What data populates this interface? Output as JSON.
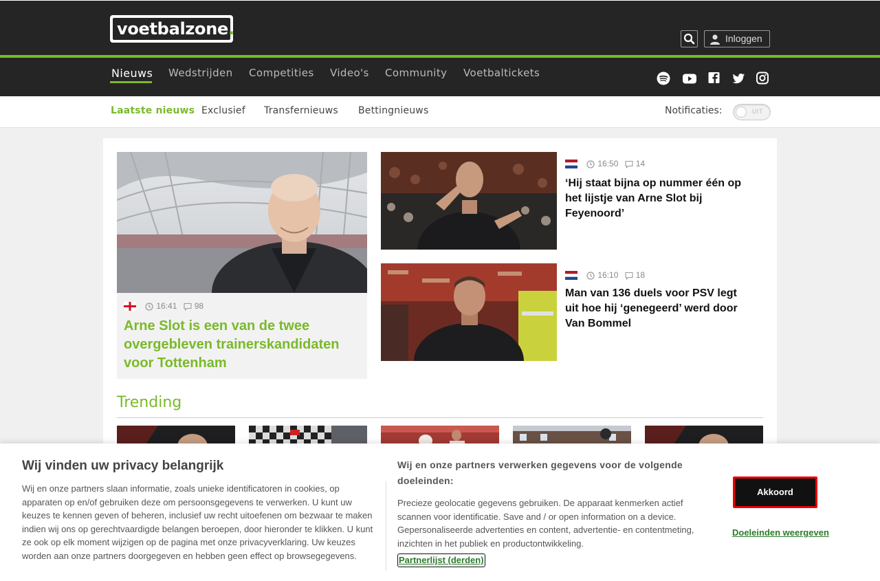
{
  "header": {
    "logo_text": "voetbalzone",
    "logo_dot": ".",
    "login_label": "Inloggen"
  },
  "nav": {
    "items": [
      "Nieuws",
      "Wedstrijden",
      "Competities",
      "Video's",
      "Community",
      "Voetbaltickets"
    ],
    "active": "Nieuws",
    "social_icons": [
      "spotify-icon",
      "youtube-icon",
      "facebook-icon",
      "twitter-icon",
      "instagram-icon"
    ]
  },
  "subnav": {
    "items": [
      "Laatste nieuws",
      "Exclusief",
      "Transfernieuws",
      "Bettingnieuws"
    ],
    "active": "Laatste nieuws",
    "notifications_label": "Notificaties:",
    "toggle_state": "UIT"
  },
  "featured": {
    "flag": "england",
    "time": "16:41",
    "comments": "98",
    "title": "Arne Slot is een van de twee overgebleven trainerskandidaten voor Tottenham"
  },
  "articles": [
    {
      "flag": "netherlands",
      "time": "16:50",
      "comments": "14",
      "title": "‘Hij staat bijna op nummer één op het lijstje van Arne Slot bij Feyenoord’"
    },
    {
      "flag": "netherlands",
      "time": "16:10",
      "comments": "18",
      "title": "Man van 136 duels voor PSV legt uit hoe hij ‘genegeerd’ werd door Van Bommel"
    }
  ],
  "trending": {
    "title": "Trending"
  },
  "consent": {
    "title": "Wij vinden uw privacy belangrijk",
    "text": "Wij en onze partners slaan informatie, zoals unieke identificatoren in cookies, op apparaten op en/of gebruiken deze om persoonsgegevens te verwerken. U kunt uw keuzes te kennen geven of beheren, inclusief uw recht uitoefenen om bezwaar te maken indien wij ons op gerechtvaardigde belangen beroepen, door hieronder te klikken. U kunt ze ook op elk moment wijzigen op de pagina met onze privacyverklaring. Uw keuzes worden aan onze partners doorgegeven en hebben geen effect op browsegegevens.",
    "purposes_title": "Wij en onze partners verwerken gegevens voor de volgende doeleinden:",
    "purposes_text": "Precieze geolocatie gegevens gebruiken. De apparaat kenmerken actief scannen voor identificatie. Save and / or open information on a device. Gepersonaliseerde advertenties en content, advertentie- en contentmeting, inzichten in het publiek en productontwikkeling.",
    "partners_link": "Partnerlijst (derden)",
    "accept_label": "Akkoord",
    "purposes_link": "Doeleinden weergeven"
  }
}
